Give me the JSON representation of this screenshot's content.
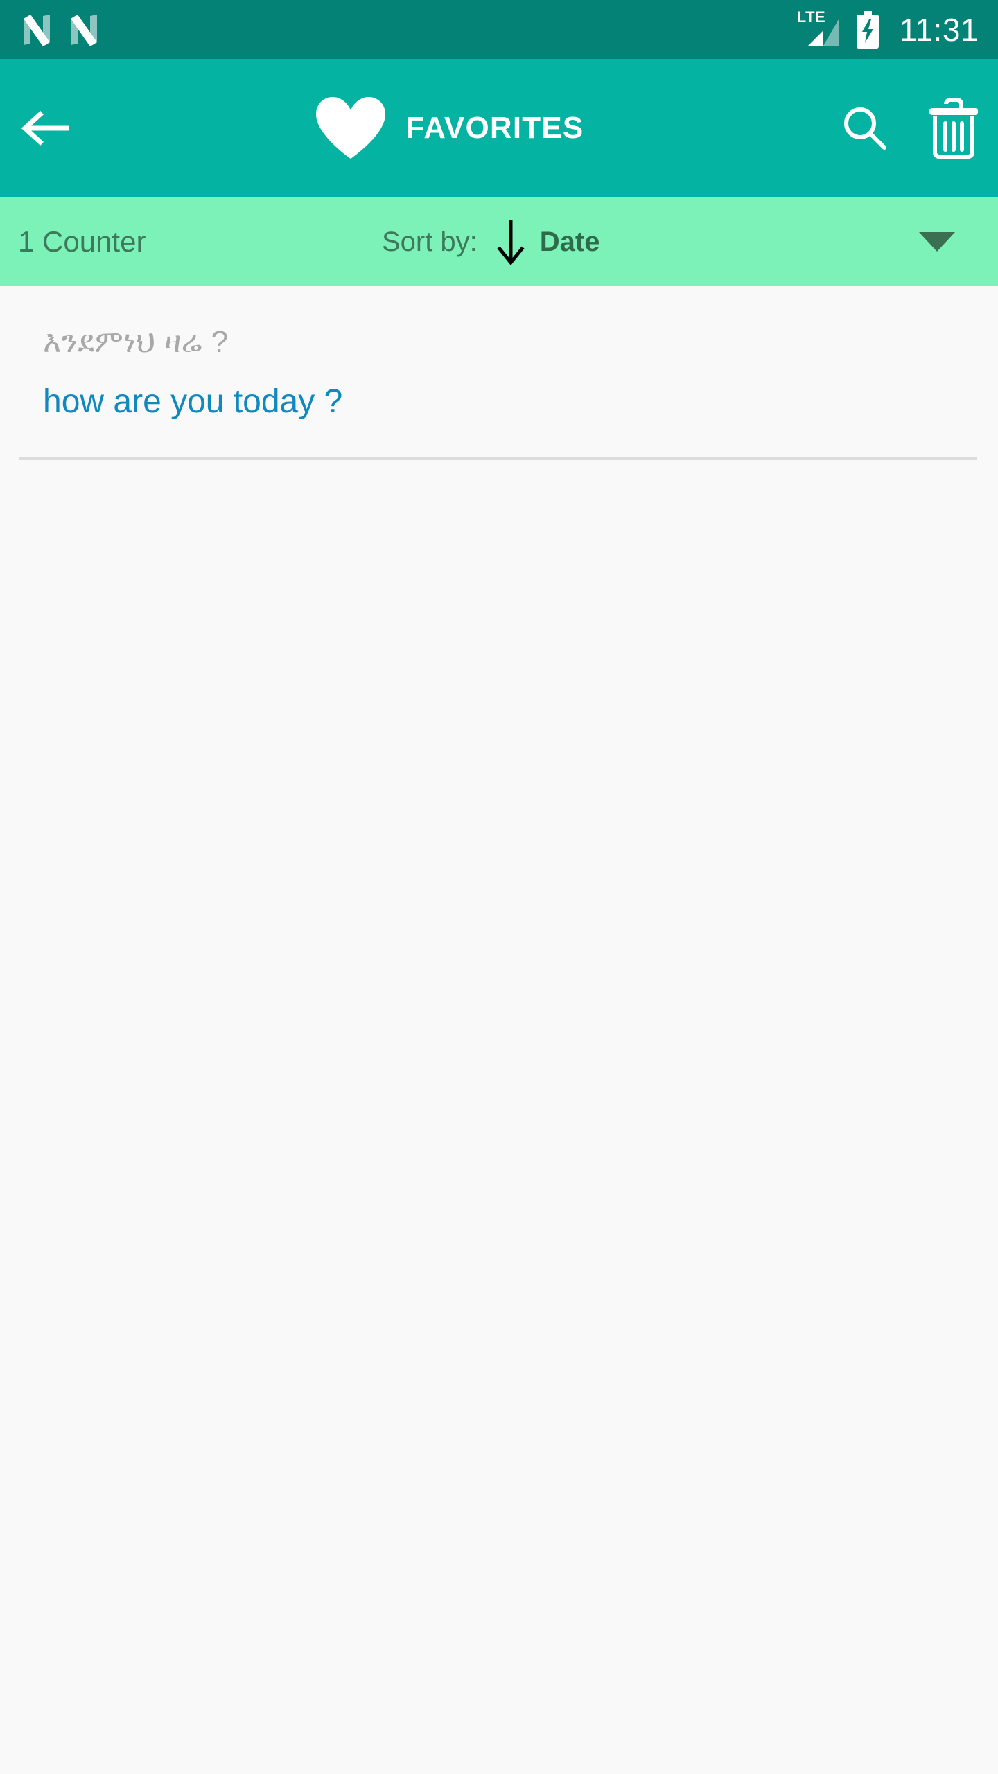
{
  "status_bar": {
    "notifications": [
      {
        "icon": "app-notification-icon"
      },
      {
        "icon": "app-notification-icon"
      }
    ],
    "network_label": "LTE",
    "signal_icon": "signal-bars-icon",
    "battery_icon": "battery-charging-icon",
    "time": "11:31",
    "background_color": "#048275"
  },
  "app_bar": {
    "back_icon": "back-arrow-icon",
    "title_icon": "heart-icon",
    "title": "FAVORITES",
    "search_icon": "search-icon",
    "delete_icon": "trash-icon",
    "background_color": "#05b3a2"
  },
  "sort_bar": {
    "counter_text": "1 Counter",
    "sort_by_label": "Sort by:",
    "sort_direction_icon": "arrow-down-icon",
    "sort_value": "Date",
    "dropdown_icon": "chevron-down-icon",
    "background_color": "#7df2b8"
  },
  "list": {
    "items": [
      {
        "source_text": "እንደምነህ ዛሬ ?",
        "translation_text": "how are you today ?",
        "translation_color": "#1189be"
      }
    ]
  }
}
